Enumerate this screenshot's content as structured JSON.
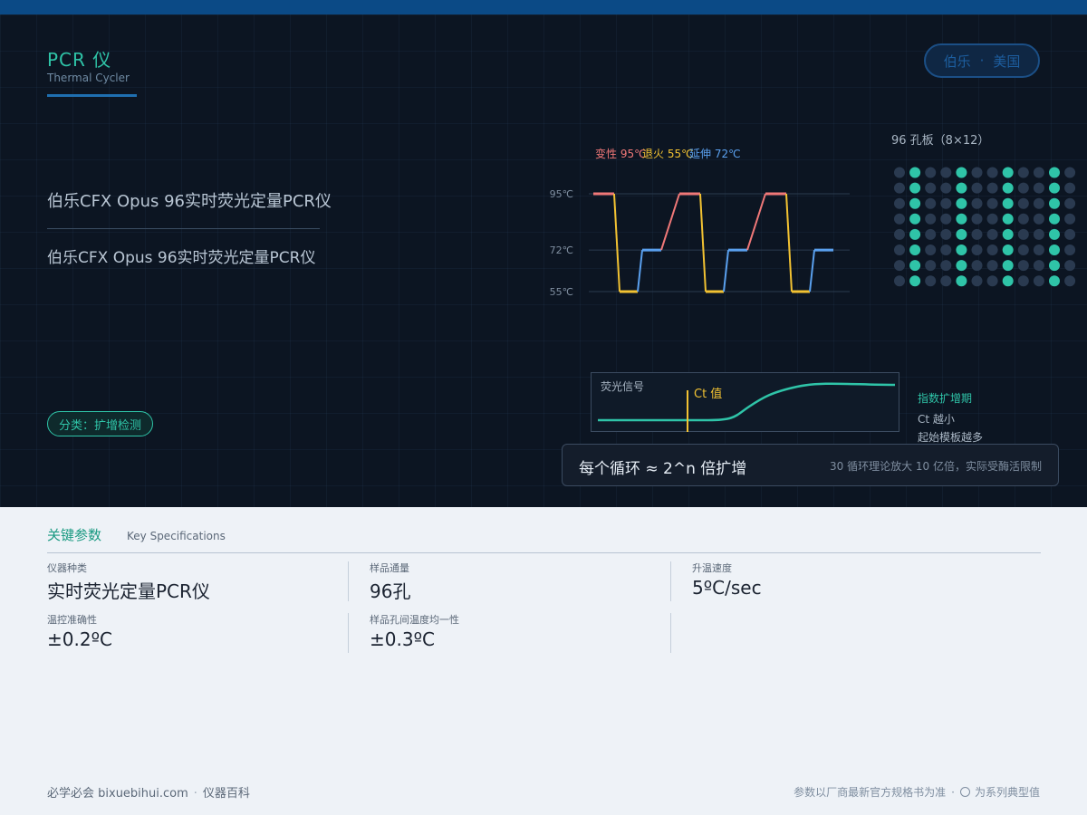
{
  "header": {
    "title": "PCR 仪",
    "subtitle": "Thermal Cycler",
    "maker": "伯乐",
    "origin": "美国",
    "maker_sep": "·"
  },
  "model": {
    "name": "伯乐CFX Opus 96实时荧光定量PCR仪",
    "name_repeat": "伯乐CFX Opus 96实时荧光定量PCR仪"
  },
  "category_tag": "分类：扩增检测",
  "cycle_chart": {
    "legend": [
      {
        "label": "变性 95℃",
        "color": "#f07878"
      },
      {
        "label": "退火 55℃",
        "color": "#f2c232"
      },
      {
        "label": "延伸 72℃",
        "color": "#5aa0ee"
      }
    ],
    "y_ticks": [
      "95℃",
      "72℃",
      "55℃"
    ]
  },
  "chart_data": {
    "type": "line",
    "title": "",
    "xlabel": "",
    "ylabel": "",
    "ylim": [
      55,
      95
    ],
    "y_ticks": [
      55,
      72,
      95
    ],
    "series": [
      {
        "name": "变性 95℃",
        "values": [
          95,
          95,
          95
        ]
      },
      {
        "name": "退火 55℃",
        "values": [
          55,
          55,
          55
        ]
      },
      {
        "name": "延伸 72℃",
        "values": [
          72,
          72,
          72
        ]
      }
    ],
    "cycles": 3
  },
  "plate": {
    "title": "96 孔板（8×12）",
    "rows": 8,
    "cols": 12,
    "filled_columns": [
      1,
      4,
      7,
      10
    ],
    "fill_color": "#2fc4a8",
    "empty_color": "#2a3a50"
  },
  "fluorescence": {
    "label": "荧光信号",
    "ct_label": "Ct 值",
    "notes": [
      "指数扩增期",
      "Ct 越小",
      "起始模板越多"
    ]
  },
  "amplification": {
    "main": "每个循环 ≈ 2^n 倍扩增",
    "sub": "30 循环理论放大 10 亿倍，实际受酶活限制"
  },
  "specs": {
    "title": "关键参数",
    "subtitle": "Key Specifications",
    "items": [
      {
        "label": "仪器种类",
        "value": "实时荧光定量PCR仪"
      },
      {
        "label": "样品通量",
        "value": "96孔"
      },
      {
        "label": "升温速度",
        "value": "5ºC/sec"
      },
      {
        "label": "温控准确性",
        "value": "±0.2ºC"
      },
      {
        "label": "样品孔间温度均一性",
        "value": "±0.3ºC"
      }
    ]
  },
  "footer": {
    "site": "必学必会 bixuebihui.com",
    "sep": "·",
    "section": "仪器百科",
    "disclaimer": "参数以厂商最新官方规格书为准",
    "typical_note": "为系列典型值"
  },
  "colors": {
    "accent": "#2fc4a8",
    "brand_bar": "#0b4a86",
    "dark_bg": "#0c1522",
    "light_bg": "#eef2f7"
  }
}
